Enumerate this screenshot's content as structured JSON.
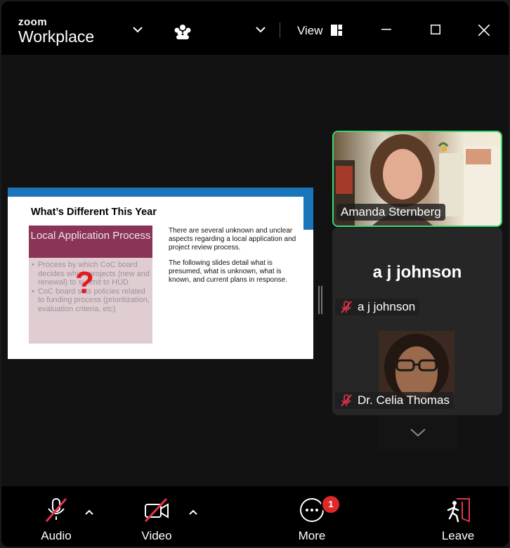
{
  "app": {
    "brand_top": "zoom",
    "brand_bottom": "Workplace"
  },
  "header": {
    "view_label": "View"
  },
  "slide": {
    "title": "What’s Different This Year",
    "box_heading": "Local Application Process",
    "box_bullets": [
      "Process by which CoC board decides which projects (new and renewal) to submit to HUD",
      "CoC board sets policies related to funding process (prioritization, evaluation criteria, etc)"
    ],
    "overlay_symbol": "?",
    "paragraph_1": "There are several unknown and unclear aspects regarding a local application and project review process.",
    "paragraph_2": "The following slides detail what is presumed, what is unknown, what is known, and current plans in response."
  },
  "participants": [
    {
      "name": "Amanda Sternberg",
      "muted": false,
      "speaking": true
    },
    {
      "name": "a j johnson",
      "muted": true,
      "display_name_large": "a j johnson"
    },
    {
      "name": "Dr. Celia Thomas",
      "muted": true
    }
  ],
  "toolbar": {
    "audio_label": "Audio",
    "video_label": "Video",
    "more_label": "More",
    "more_badge": "1",
    "leave_label": "Leave"
  },
  "colors": {
    "accent_speaking": "#3bd972",
    "badge": "#e02828",
    "muted_icon": "#e0344c",
    "slide_header": "#8a3557",
    "slide_bar": "#1b75bb"
  }
}
